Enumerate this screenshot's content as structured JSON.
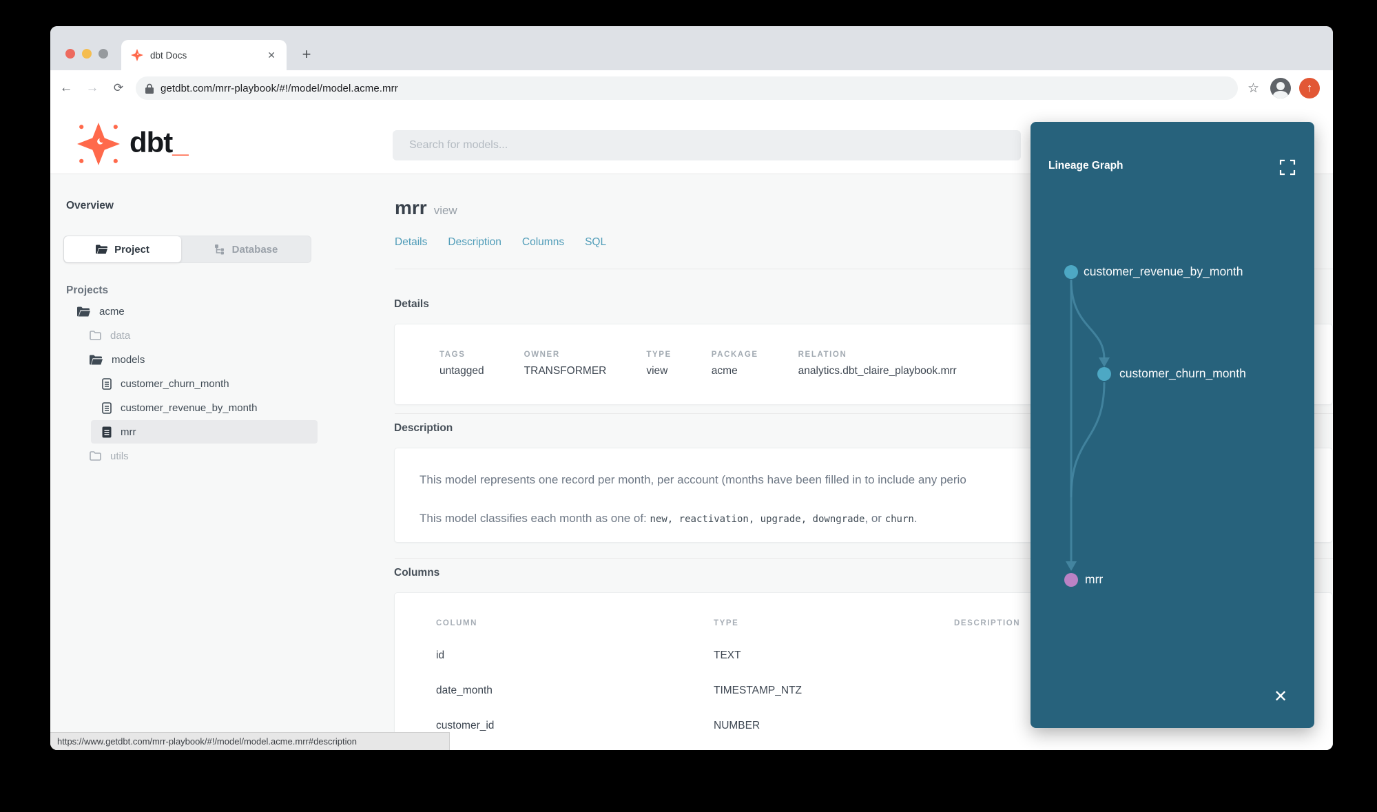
{
  "browser": {
    "tab_title": "dbt Docs",
    "tab_close": "✕",
    "new_tab": "+",
    "back": "←",
    "forward": "→",
    "reload": "⟳",
    "star": "☆",
    "url": "getdbt.com/mrr-playbook/#!/model/model.acme.mrr",
    "update_arrow": "↑",
    "status_url": "https://www.getdbt.com/mrr-playbook/#!/model/model.acme.mrr#description"
  },
  "header": {
    "logo_text": "dbt",
    "logo_cursor": "_",
    "search_placeholder": "Search for models..."
  },
  "sidebar": {
    "overview": "Overview",
    "tab_project": "Project",
    "tab_database": "Database",
    "projects_heading": "Projects",
    "tree": [
      {
        "label": "acme"
      },
      {
        "label": "data"
      },
      {
        "label": "models"
      },
      {
        "label": "customer_churn_month"
      },
      {
        "label": "customer_revenue_by_month"
      },
      {
        "label": "mrr"
      },
      {
        "label": "utils"
      }
    ]
  },
  "model": {
    "title": "mrr",
    "badge": "view",
    "tabs": [
      {
        "label": "Details"
      },
      {
        "label": "Description"
      },
      {
        "label": "Columns"
      },
      {
        "label": "SQL"
      }
    ]
  },
  "details": {
    "heading": "Details",
    "fields": [
      {
        "label": "TAGS",
        "value": "untagged"
      },
      {
        "label": "OWNER",
        "value": "TRANSFORMER"
      },
      {
        "label": "TYPE",
        "value": "view"
      },
      {
        "label": "PACKAGE",
        "value": "acme"
      },
      {
        "label": "RELATION",
        "value": "analytics.dbt_claire_playbook.mrr"
      }
    ]
  },
  "description": {
    "heading": "Description",
    "line1": "This model represents one record per month, per account (months have been filled in to include any perio",
    "line2_prefix": "This model classifies each month as one of: ",
    "code_new": "new",
    "sep1": ", ",
    "code_reactivation": "reactivation",
    "sep2": ", ",
    "code_upgrade": "upgrade",
    "sep3": ", ",
    "code_downgrade": "downgrade",
    "sep_or": ", or ",
    "code_churn": "churn",
    "suffix": "."
  },
  "columns": {
    "heading": "Columns",
    "headers": [
      "COLUMN",
      "TYPE",
      "DESCRIPTION"
    ],
    "rows": [
      {
        "column": "id",
        "type": "TEXT",
        "description": ""
      },
      {
        "column": "date_month",
        "type": "TIMESTAMP_NTZ",
        "description": ""
      },
      {
        "column": "customer_id",
        "type": "NUMBER",
        "description": ""
      }
    ]
  },
  "lineage": {
    "title": "Lineage Graph",
    "close": "✕",
    "nodes": [
      {
        "label": "customer_revenue_by_month",
        "color": "#4da8c4"
      },
      {
        "label": "customer_churn_month",
        "color": "#4da8c4"
      },
      {
        "label": "mrr",
        "color": "#bb82c5"
      }
    ]
  },
  "colors": {
    "brand_orange": "#ff694b",
    "link_teal": "#4f9cb8",
    "panel_teal": "#27627c",
    "edge_teal": "#4788a3",
    "node_teal": "#4da8c4",
    "node_purple": "#bb82c5"
  }
}
